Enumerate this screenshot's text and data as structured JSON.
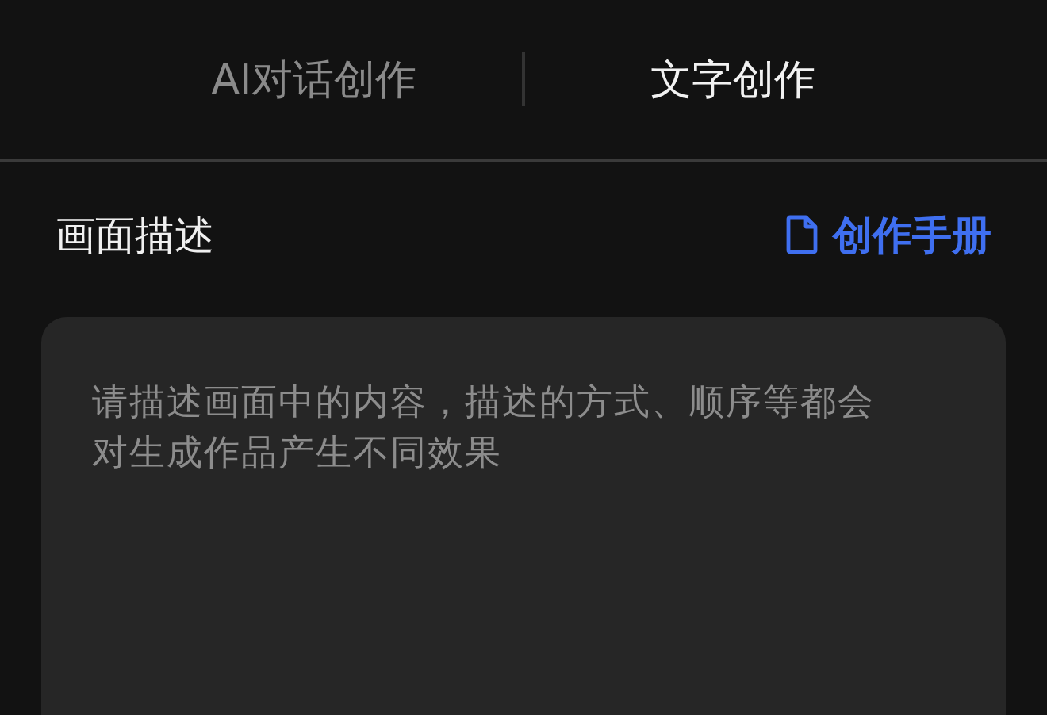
{
  "tabs": [
    {
      "label": "AI对话创作",
      "selected": false
    },
    {
      "label": "文字创作",
      "selected": true
    }
  ],
  "section": {
    "title": "画面描述",
    "link": "创作手册"
  },
  "description": {
    "placeholder": "请描述画面中的内容，描述的方式、顺序等都会对生成作品产生不同效果"
  }
}
